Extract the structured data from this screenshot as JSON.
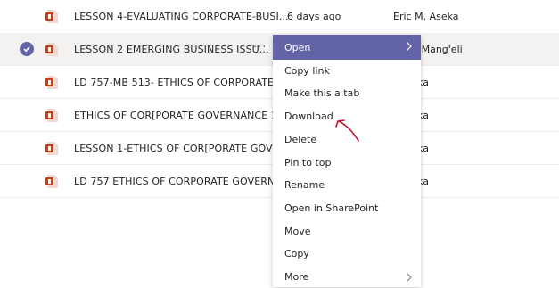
{
  "files": [
    {
      "name": "LESSON 4-EVALUATING CORPORATE-BUSI...",
      "modified": "6 days ago",
      "author": "Eric M. Aseka",
      "selected": false
    },
    {
      "name": "LESSON 2 EMERGING BUSINESS ISSU...",
      "modified": "",
      "author": "ell N. Mang'eli",
      "selected": true
    },
    {
      "name": "LD 757-MB 513- ETHICS OF CORPORATE G...",
      "modified": "",
      "author": ". Aseka",
      "selected": false
    },
    {
      "name": "ETHICS OF COR[PORATE GOVERNANCE 1.p...",
      "modified": "",
      "author": ". Aseka",
      "selected": false
    },
    {
      "name": "LESSON 1-ETHICS OF COR[PORATE GOVER...",
      "modified": "",
      "author": ". Aseka",
      "selected": false
    },
    {
      "name": "LD 757 ETHICS OF CORPORATE GOVERNA...",
      "modified": "",
      "author": ". Aseka",
      "selected": false
    }
  ],
  "row_more_ellipsis": "···",
  "context_menu": {
    "items": [
      {
        "label": "Open",
        "has_submenu": true
      },
      {
        "label": "Copy link",
        "has_submenu": false
      },
      {
        "label": "Make this a tab",
        "has_submenu": false
      },
      {
        "label": "Download",
        "has_submenu": false
      },
      {
        "label": "Delete",
        "has_submenu": false
      },
      {
        "label": "Pin to top",
        "has_submenu": false
      },
      {
        "label": "Rename",
        "has_submenu": false
      },
      {
        "label": "Open in SharePoint",
        "has_submenu": false
      },
      {
        "label": "Move",
        "has_submenu": false
      },
      {
        "label": "Copy",
        "has_submenu": false
      },
      {
        "label": "More",
        "has_submenu": true
      }
    ]
  },
  "colors": {
    "accent": "#6264a7",
    "ppt_icon": "#c43e1c",
    "annotation": "#c8102e"
  },
  "icons": {
    "file": "powerpoint-file-icon",
    "selected": "checkmark-circle-icon",
    "submenu": "chevron-right-icon",
    "annotation": "hand-drawn-arrow-icon"
  }
}
